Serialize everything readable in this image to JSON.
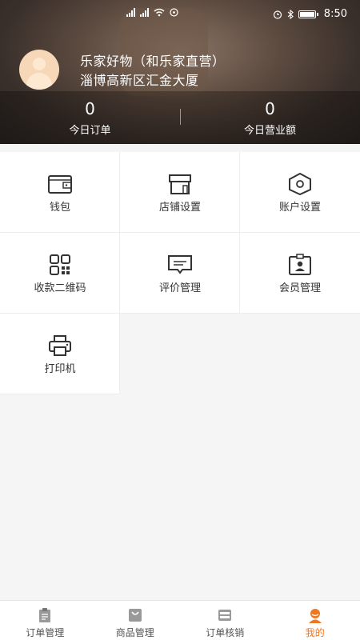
{
  "status_bar": {
    "time": "8:50"
  },
  "profile": {
    "shop_name": "乐家好物（和乐家直营）",
    "address": "淄博高新区汇金大厦"
  },
  "stats": [
    {
      "value": "0",
      "label": "今日订单"
    },
    {
      "value": "0",
      "label": "今日营业额"
    }
  ],
  "menu": [
    {
      "label": "钱包",
      "icon": "wallet-icon"
    },
    {
      "label": "店铺设置",
      "icon": "store-icon"
    },
    {
      "label": "账户设置",
      "icon": "hexagon-settings-icon"
    },
    {
      "label": "收款二维码",
      "icon": "qr-code-icon"
    },
    {
      "label": "评价管理",
      "icon": "comment-icon"
    },
    {
      "label": "会员管理",
      "icon": "member-card-icon"
    },
    {
      "label": "打印机",
      "icon": "printer-icon"
    }
  ],
  "tabs": [
    {
      "label": "订单管理",
      "icon": "clipboard-icon"
    },
    {
      "label": "商品管理",
      "icon": "shopping-bag-icon"
    },
    {
      "label": "订单核销",
      "icon": "scan-icon"
    },
    {
      "label": "我的",
      "icon": "user-icon",
      "active": true
    }
  ],
  "colors": {
    "accent": "#f07722",
    "icon": "#333333"
  }
}
